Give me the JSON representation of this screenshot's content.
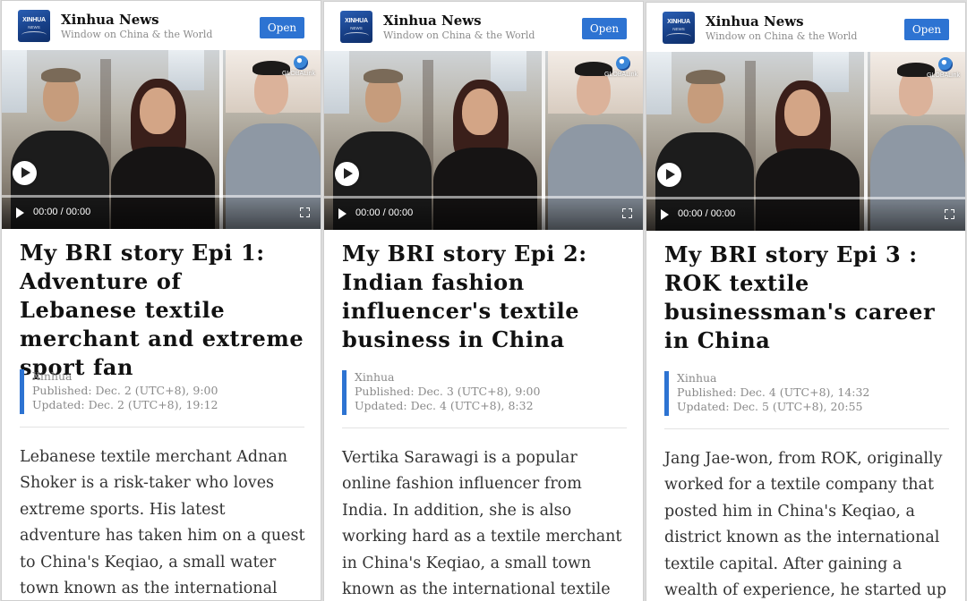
{
  "panels": [
    {
      "brand": "Xinhua News",
      "logo_text": "XINHUA",
      "logo_sub": "NEWS",
      "tagline": "Window on China & the World",
      "open_label": "Open",
      "video": {
        "time": "00:00 / 00:00",
        "globe_label": "GLOBALink"
      },
      "title": "My BRI story Epi 1: Adventure of Lebanese textile merchant and extreme sport fan",
      "source": "Xinhua",
      "published": "Published: Dec. 2 (UTC+8), 9:00",
      "updated": "Updated: Dec. 2 (UTC+8), 19:12",
      "body": "Lebanese textile merchant Adnan Shoker is a risk-taker who loves extreme sports. His latest adventure has taken him on a quest to China's Keqiao, a small water town known as the international textile capital."
    },
    {
      "brand": "Xinhua News",
      "logo_text": "XINHUA",
      "logo_sub": "NEWS",
      "tagline": "Window on China & the World",
      "open_label": "Open",
      "video": {
        "time": "00:00 / 00:00",
        "globe_label": "GLOBALink"
      },
      "title": "My BRI story Epi 2: Indian fashion influencer's textile business in China",
      "source": "Xinhua",
      "published": "Published: Dec. 3 (UTC+8), 9:00",
      "updated": "Updated: Dec. 4 (UTC+8), 8:32",
      "body": "Vertika Sarawagi is a popular online fashion influencer from India. In addition, she is also working hard as a textile merchant in China's Keqiao, a small town known as the international textile capital. Check"
    },
    {
      "brand": "Xinhua News",
      "logo_text": "XINHUA",
      "logo_sub": "NEWS",
      "tagline": "Window on China & the World",
      "open_label": "Open",
      "video": {
        "time": "00:00 / 00:00",
        "globe_label": "GLOBALink"
      },
      "title": "My BRI story Epi 3 : ROK textile businessman's career in China",
      "source": "Xinhua",
      "published": "Published: Dec. 4 (UTC+8), 14:32",
      "updated": "Updated: Dec. 5 (UTC+8), 20:55",
      "body": "Jang Jae-won, from ROK, originally worked for a textile company that posted him in China's Keqiao, a district known as the international textile capital. After gaining a wealth of experience, he started up his own"
    }
  ],
  "colors": {
    "accent": "#2d73d2",
    "title_text": "#111111",
    "meta_text": "#8a8a8a",
    "body_text": "#333333"
  }
}
